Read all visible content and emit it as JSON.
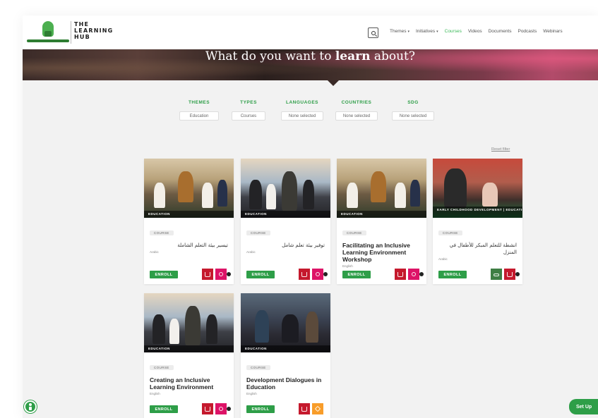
{
  "brand": {
    "line1": "THE",
    "line2": "LEARNING",
    "line3": "HUB"
  },
  "nav": {
    "items": [
      {
        "label": "Themes",
        "dropdown": true,
        "active": false
      },
      {
        "label": "Initiatives",
        "dropdown": true,
        "active": false
      },
      {
        "label": "Courses",
        "dropdown": false,
        "active": true
      },
      {
        "label": "Videos",
        "dropdown": false,
        "active": false
      },
      {
        "label": "Documents",
        "dropdown": false,
        "active": false
      },
      {
        "label": "Podcasts",
        "dropdown": false,
        "active": false
      },
      {
        "label": "Webinars",
        "dropdown": false,
        "active": false
      }
    ]
  },
  "hero": {
    "title_prefix": "What do you want to",
    "title_bold": "learn",
    "title_suffix": "about?"
  },
  "filters": [
    {
      "label": "THEMES",
      "value": "Education"
    },
    {
      "label": "TYPES",
      "value": "Courses"
    },
    {
      "label": "LANGUAGES",
      "value": "None selected"
    },
    {
      "label": "COUNTRIES",
      "value": "None selected"
    },
    {
      "label": "SDG",
      "value": "None selected"
    }
  ],
  "reset_label": "Reset filter",
  "cards": [
    {
      "tag": "EDUCATION",
      "type": "COURSE",
      "title": "تيسير بيئة التعلم الشاملة",
      "lang": "Arabic",
      "rtl": true,
      "enroll": "ENROLL",
      "sdgs": [
        "red",
        "pink"
      ],
      "scene": "classroom"
    },
    {
      "tag": "EDUCATION",
      "type": "COURSE",
      "title": "توفير بيئة تعلم شامل",
      "lang": "Arabic",
      "rtl": true,
      "enroll": "ENROLL",
      "sdgs": [
        "red",
        "pink"
      ],
      "scene": "classroom2"
    },
    {
      "tag": "EDUCATION",
      "type": "COURSE",
      "title": "Facilitating an Inclusive Learning Environment Workshop",
      "lang": "English",
      "rtl": false,
      "enroll": "ENROLL",
      "sdgs": [
        "red",
        "pink"
      ],
      "scene": "classroom"
    },
    {
      "tag": "EARLY CHILDHOOD DEVELOPMENT | EDUCATION",
      "type": "COURSE",
      "title": "انشطة للتعلم المبكر للأطفال في المنزل",
      "lang": "Arabic",
      "rtl": true,
      "enroll": "ENROLL",
      "sdgs": [
        "green",
        "red"
      ],
      "scene": "mother"
    },
    {
      "tag": "EDUCATION",
      "type": "COURSE",
      "title": "Creating an Inclusive Learning Environment",
      "lang": "English",
      "rtl": false,
      "enroll": "ENROLL",
      "sdgs": [
        "red",
        "pink"
      ],
      "scene": "classroom2"
    },
    {
      "tag": "EDUCATION",
      "type": "COURSE",
      "title": "Development Dialogues in Education",
      "lang": "English",
      "rtl": false,
      "enroll": "ENROLL",
      "sdgs": [
        "red",
        "orange"
      ],
      "scene": "dark"
    }
  ],
  "setup_label": "Set Up",
  "icons": {
    "search": "search-icon",
    "accessibility": "accessibility-icon"
  },
  "colors": {
    "accent": "#2e9e48",
    "active_nav": "#3cb95a"
  }
}
